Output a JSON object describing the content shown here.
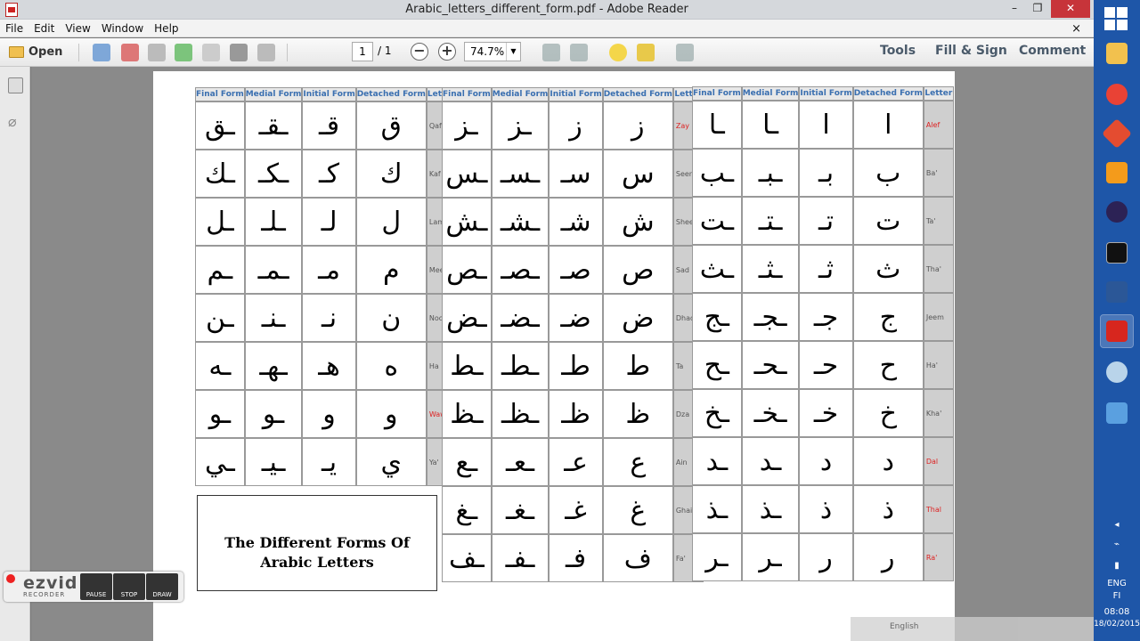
{
  "window": {
    "title": "Arabic_letters_different_form.pdf - Adobe Reader",
    "min": "–",
    "max": "❐",
    "close": "✕"
  },
  "menu": [
    "File",
    "Edit",
    "View",
    "Window",
    "Help"
  ],
  "menu_close": "×",
  "toolbar": {
    "open_label": "Open",
    "page_current": "1",
    "page_total": "/ 1",
    "zoom": "74.7%",
    "tools": "Tools",
    "fill_sign": "Fill & Sign",
    "comment": "Comment"
  },
  "headers": [
    "Final Form",
    "Medial Form",
    "Initial Form",
    "Detached Form",
    "Letter"
  ],
  "table1": [
    {
      "final": "ـق",
      "medial": "ـقـ",
      "initial": "قـ",
      "detached": "ق",
      "name": "Qaf",
      "red": false
    },
    {
      "final": "ـك",
      "medial": "ـكـ",
      "initial": "كـ",
      "detached": "ك",
      "name": "Kaf",
      "red": false
    },
    {
      "final": "ـل",
      "medial": "ـلـ",
      "initial": "لـ",
      "detached": "ل",
      "name": "Lam",
      "red": false
    },
    {
      "final": "ـم",
      "medial": "ـمـ",
      "initial": "مـ",
      "detached": "م",
      "name": "Meem",
      "red": false
    },
    {
      "final": "ـن",
      "medial": "ـنـ",
      "initial": "نـ",
      "detached": "ن",
      "name": "Noon",
      "red": false
    },
    {
      "final": "ـه",
      "medial": "ـهـ",
      "initial": "هـ",
      "detached": "ه",
      "name": "Ha",
      "red": false
    },
    {
      "final": "ـو",
      "medial": "ـو",
      "initial": "و",
      "detached": "و",
      "name": "Waw",
      "red": true
    },
    {
      "final": "ـي",
      "medial": "ـيـ",
      "initial": "يـ",
      "detached": "ي",
      "name": "Ya'",
      "red": false
    }
  ],
  "table2": [
    {
      "final": "ـز",
      "medial": "ـز",
      "initial": "ز",
      "detached": "ز",
      "name": "Zay",
      "red": true
    },
    {
      "final": "ـس",
      "medial": "ـسـ",
      "initial": "سـ",
      "detached": "س",
      "name": "Seen",
      "red": false
    },
    {
      "final": "ـش",
      "medial": "ـشـ",
      "initial": "شـ",
      "detached": "ش",
      "name": "Sheen",
      "red": false
    },
    {
      "final": "ـص",
      "medial": "ـصـ",
      "initial": "صـ",
      "detached": "ص",
      "name": "Sad",
      "red": false
    },
    {
      "final": "ـض",
      "medial": "ـضـ",
      "initial": "ضـ",
      "detached": "ض",
      "name": "Dhad",
      "red": false
    },
    {
      "final": "ـط",
      "medial": "ـطـ",
      "initial": "طـ",
      "detached": "ط",
      "name": "Ta",
      "red": false
    },
    {
      "final": "ـظ",
      "medial": "ـظـ",
      "initial": "ظـ",
      "detached": "ظ",
      "name": "Dza",
      "red": false
    },
    {
      "final": "ـع",
      "medial": "ـعـ",
      "initial": "عـ",
      "detached": "ع",
      "name": "Ain",
      "red": false
    },
    {
      "final": "ـغ",
      "medial": "ـغـ",
      "initial": "غـ",
      "detached": "غ",
      "name": "Ghain",
      "red": false
    },
    {
      "final": "ـف",
      "medial": "ـفـ",
      "initial": "فـ",
      "detached": "ف",
      "name": "Fa'",
      "red": false
    }
  ],
  "table3": [
    {
      "final": "ـا",
      "medial": "ـا",
      "initial": "ا",
      "detached": "ا",
      "name": "Alef",
      "red": true
    },
    {
      "final": "ـب",
      "medial": "ـبـ",
      "initial": "بـ",
      "detached": "ب",
      "name": "Ba'",
      "red": false
    },
    {
      "final": "ـت",
      "medial": "ـتـ",
      "initial": "تـ",
      "detached": "ت",
      "name": "Ta'",
      "red": false
    },
    {
      "final": "ـث",
      "medial": "ـثـ",
      "initial": "ثـ",
      "detached": "ث",
      "name": "Tha'",
      "red": false
    },
    {
      "final": "ـج",
      "medial": "ـجـ",
      "initial": "جـ",
      "detached": "ج",
      "name": "Jeem",
      "red": false
    },
    {
      "final": "ـح",
      "medial": "ـحـ",
      "initial": "حـ",
      "detached": "ح",
      "name": "Ha'",
      "red": false
    },
    {
      "final": "ـخ",
      "medial": "ـخـ",
      "initial": "خـ",
      "detached": "خ",
      "name": "Kha'",
      "red": false
    },
    {
      "final": "ـد",
      "medial": "ـد",
      "initial": "د",
      "detached": "د",
      "name": "Dal",
      "red": true
    },
    {
      "final": "ـذ",
      "medial": "ـذ",
      "initial": "ذ",
      "detached": "ذ",
      "name": "Thal",
      "red": true
    },
    {
      "final": "ـر",
      "medial": "ـر",
      "initial": "ر",
      "detached": "ر",
      "name": "Ra'",
      "red": true
    }
  ],
  "caption": "The Different Forms Of Arabic Letters",
  "ezvid": {
    "logo": "ezvid",
    "sub": "RECORDER",
    "pause": "PAUSE",
    "stop": "STOP",
    "draw": "DRAW"
  },
  "taskbar": {
    "lang1": "ENG",
    "lang2": "FI",
    "time": "08:08",
    "date": "18/02/2015",
    "expand": "◂"
  },
  "lang_bar": "English"
}
